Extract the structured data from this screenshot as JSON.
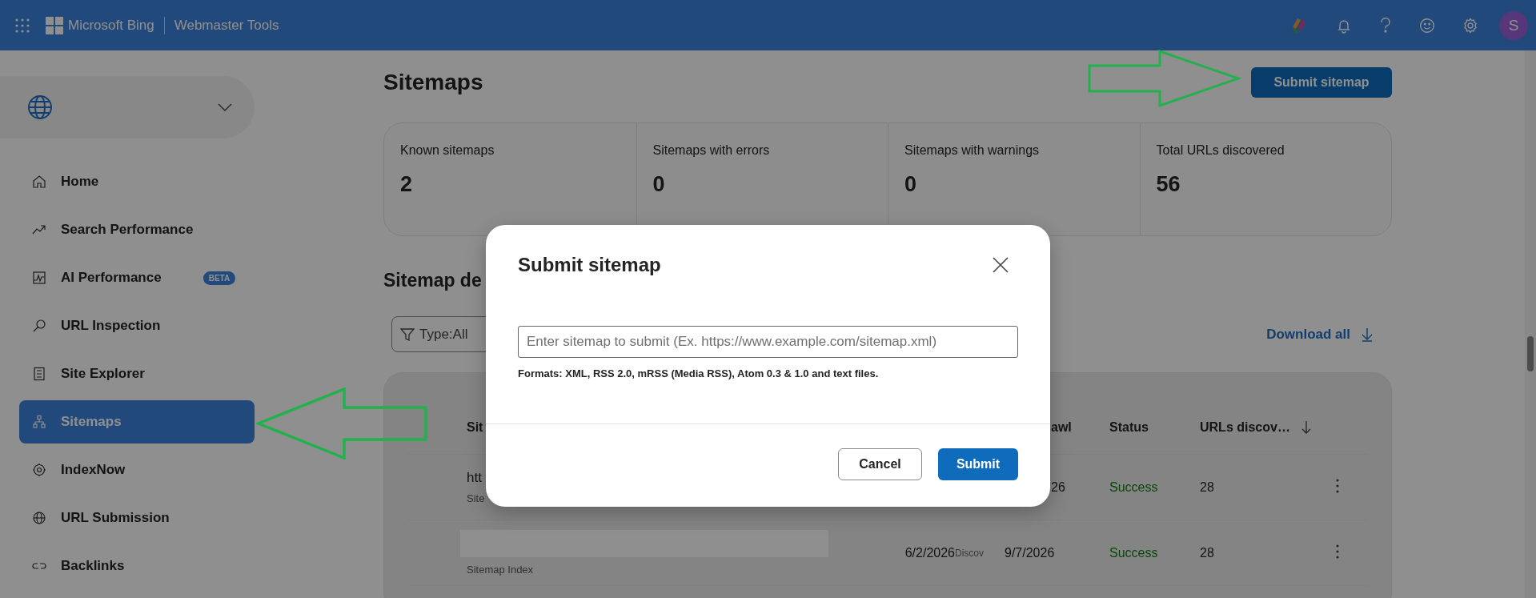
{
  "top_bar": {
    "brand": "Microsoft Bing",
    "product": "Webmaster Tools",
    "avatar_initial": "S"
  },
  "sidebar": {
    "items": [
      {
        "label": "Home",
        "selected": false
      },
      {
        "label": "Search Performance",
        "selected": false
      },
      {
        "label": "AI Performance",
        "badge": "BETA",
        "selected": false
      },
      {
        "label": "URL Inspection",
        "selected": false
      },
      {
        "label": "Site Explorer",
        "selected": false
      },
      {
        "label": "Sitemaps",
        "selected": true
      },
      {
        "label": "IndexNow",
        "selected": false
      },
      {
        "label": "URL Submission",
        "selected": false
      },
      {
        "label": "Backlinks",
        "selected": false
      }
    ]
  },
  "page": {
    "title": "Sitemaps",
    "submit_button": "Submit sitemap"
  },
  "stats": [
    {
      "label": "Known sitemaps",
      "value": "2"
    },
    {
      "label": "Sitemaps with errors",
      "value": "0"
    },
    {
      "label": "Sitemaps with warnings",
      "value": "0"
    },
    {
      "label": "Total URLs discovered",
      "value": "56"
    }
  ],
  "details": {
    "heading": "Sitemap de",
    "filter": "Type:All",
    "download": "Download all"
  },
  "table": {
    "columns": [
      {
        "label": "Sit",
        "sorted": false
      },
      {
        "label": "awl",
        "sorted": false
      },
      {
        "label": "Status",
        "sorted": false
      },
      {
        "label": "URLs discov…",
        "sorted": true
      }
    ],
    "rows": [
      {
        "name": "htt",
        "redacted": false,
        "type": "Site",
        "last_crawl": "26",
        "status": "Success",
        "urls": "28"
      },
      {
        "redacted": true,
        "type": "Sitemap Index",
        "submitted": "6/2/2026",
        "column_5": "Discov",
        "last_crawl": "9/7/2026",
        "status": "Success",
        "urls": "28"
      }
    ]
  },
  "dialog": {
    "title": "Submit sitemap",
    "placeholder": "Enter sitemap to submit (Ex. https://www.example.com/sitemap.xml)",
    "hint": "Formats: XML, RSS 2.0, mRSS (Media RSS), Atom 0.3 & 1.0 and text files.",
    "cancel": "Cancel",
    "submit": "Submit"
  },
  "annotations": [
    {
      "kind": "right_arrow"
    },
    {
      "kind": "left_arrow"
    }
  ]
}
